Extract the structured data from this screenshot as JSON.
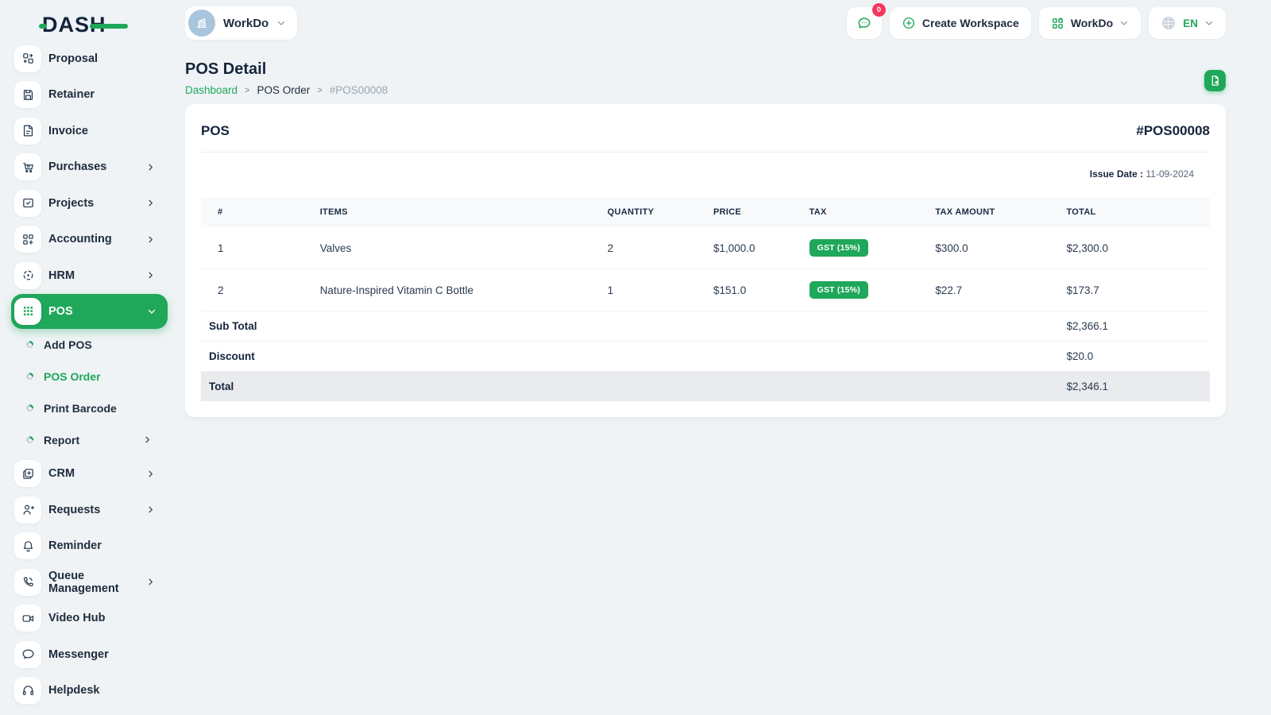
{
  "brand": {
    "name": "DASH"
  },
  "colors": {
    "accent": "#1FA75A",
    "badge": "#F5365C"
  },
  "topbar": {
    "workspace_selector": "WorkDo",
    "chat_badge": "0",
    "create_workspace_label": "Create Workspace",
    "workspace_menu_label": "WorkDo",
    "language": "EN"
  },
  "sidebar": {
    "top": [
      {
        "label": "Proposal",
        "icon": "proposal-icon"
      },
      {
        "label": "Retainer",
        "icon": "retainer-icon"
      },
      {
        "label": "Invoice",
        "icon": "invoice-icon"
      },
      {
        "label": "Purchases",
        "icon": "purchases-icon",
        "expandable": true
      },
      {
        "label": "Projects",
        "icon": "projects-icon",
        "expandable": true
      },
      {
        "label": "Accounting",
        "icon": "accounting-icon",
        "expandable": true
      },
      {
        "label": "HRM",
        "icon": "hrm-icon",
        "expandable": true
      }
    ],
    "active_item": {
      "label": "POS",
      "icon": "pos-icon",
      "expanded": true
    },
    "pos_children": [
      {
        "label": "Add POS"
      },
      {
        "label": "POS Order",
        "active": true
      },
      {
        "label": "Print Barcode"
      },
      {
        "label": "Report",
        "expandable": true
      }
    ],
    "bottom": [
      {
        "label": "CRM",
        "icon": "crm-icon",
        "expandable": true
      },
      {
        "label": "Requests",
        "icon": "requests-icon",
        "expandable": true
      },
      {
        "label": "Reminder",
        "icon": "reminder-icon"
      },
      {
        "label": "Queue Management",
        "icon": "queue-management-icon",
        "expandable": true
      },
      {
        "label": "Video Hub",
        "icon": "video-hub-icon"
      },
      {
        "label": "Messenger",
        "icon": "messenger-icon"
      },
      {
        "label": "Helpdesk",
        "icon": "helpdesk-icon"
      }
    ]
  },
  "page": {
    "title": "POS Detail",
    "breadcrumb": [
      "Dashboard",
      "POS Order",
      "#POS00008"
    ],
    "crumb_sep": ">"
  },
  "card": {
    "heading": "POS",
    "ref": "#POS00008",
    "issue_date_label": "Issue Date :",
    "issue_date": "11-09-2024"
  },
  "table": {
    "columns": [
      "#",
      "ITEMS",
      "QUANTITY",
      "PRICE",
      "TAX",
      "TAX AMOUNT",
      "TOTAL"
    ],
    "rows": [
      {
        "num": "1",
        "item": "Valves",
        "qty": "2",
        "price": "$1,000.0",
        "tax": "GST (15%)",
        "tax_amount": "$300.0",
        "total": "$2,300.0"
      },
      {
        "num": "2",
        "item": "Nature-Inspired Vitamin C Bottle",
        "qty": "1",
        "price": "$151.0",
        "tax": "GST (15%)",
        "tax_amount": "$22.7",
        "total": "$173.7"
      }
    ],
    "summary": [
      {
        "label": "Sub Total",
        "value": "$2,366.1"
      },
      {
        "label": "Discount",
        "value": "$20.0"
      },
      {
        "label": "Total",
        "value": "$2,346.1"
      }
    ]
  }
}
